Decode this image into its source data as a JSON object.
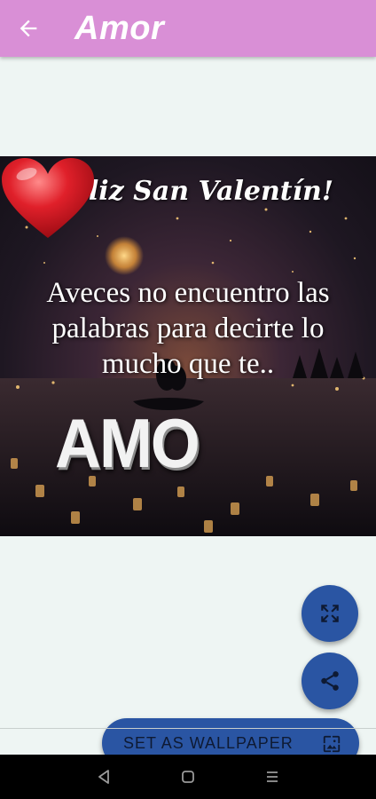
{
  "appbar": {
    "title": "Amor",
    "back_icon": "arrow-back-icon",
    "background": "#d98fd6"
  },
  "image": {
    "headline": "¡Feliz San Valentín!",
    "message": "Aveces no encuentro las palabras para decirte lo mucho que te..",
    "emphasis": "AMO",
    "heart_color": "#e0202a"
  },
  "actions": {
    "fullscreen_icon": "fullscreen-icon",
    "share_icon": "share-icon",
    "set_wallpaper_label": "SET AS WALLPAPER",
    "wallpaper_icon": "wallpaper-icon",
    "accent": "#2a55a3"
  },
  "navbar": {
    "back_icon": "nav-back-icon",
    "home_icon": "nav-home-icon",
    "recents_icon": "nav-menu-icon"
  }
}
